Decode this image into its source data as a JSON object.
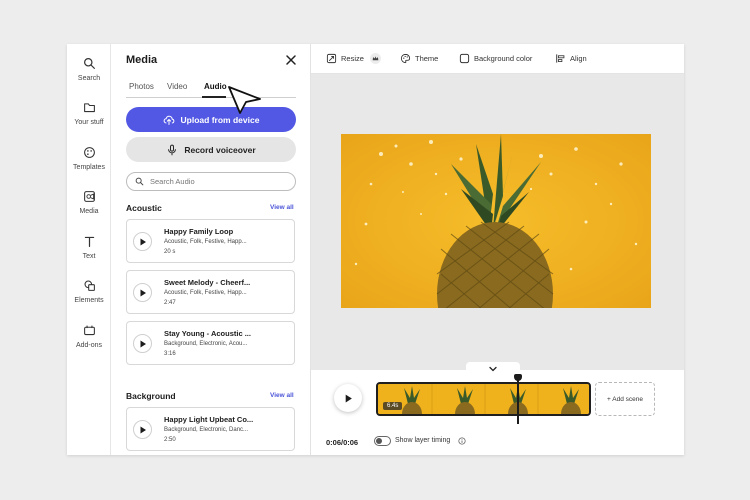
{
  "rail": {
    "items": [
      {
        "label": "Search",
        "icon": "search-icon"
      },
      {
        "label": "Your stuff",
        "icon": "folder-icon"
      },
      {
        "label": "Templates",
        "icon": "templates-icon"
      },
      {
        "label": "Media",
        "icon": "media-icon"
      },
      {
        "label": "Text",
        "icon": "text-icon"
      },
      {
        "label": "Elements",
        "icon": "elements-icon"
      },
      {
        "label": "Add-ons",
        "icon": "add-ons-icon"
      }
    ]
  },
  "panel": {
    "title": "Media",
    "tabs": [
      {
        "label": "Photos"
      },
      {
        "label": "Video"
      },
      {
        "label": "Audio",
        "active": true
      }
    ],
    "upload_label": "Upload from device",
    "record_label": "Record voiceover",
    "search_placeholder": "Search Audio",
    "sections": [
      {
        "title": "Acoustic",
        "view_all": "View all",
        "tracks": [
          {
            "name": "Happy Family Loop",
            "tags": "Acoustic, Folk, Festive, Happ...",
            "duration": "20 s"
          },
          {
            "name": "Sweet Melody - Cheerf...",
            "tags": "Acoustic, Folk, Festive, Happ...",
            "duration": "2:47"
          },
          {
            "name": "Stay Young - Acoustic ...",
            "tags": "Background, Electronic, Acou...",
            "duration": "3:16"
          }
        ]
      },
      {
        "title": "Background",
        "view_all": "View all",
        "tracks": [
          {
            "name": "Happy Light Upbeat Co...",
            "tags": "Background, Electronic, Danc...",
            "duration": "2:50"
          }
        ]
      }
    ]
  },
  "toolbar": {
    "resize_label": "Resize",
    "theme_label": "Theme",
    "background_label": "Background color",
    "align_label": "Align"
  },
  "timeline": {
    "clip_duration": "6.4s",
    "add_scene_label": "+ Add scene",
    "time": "0:06/0:06",
    "layer_timing_label": "Show layer timing",
    "layer_timing_on": false
  },
  "colors": {
    "accent": "#5258e4",
    "link": "#4b55d8",
    "photo_background": "#f0b21c"
  }
}
